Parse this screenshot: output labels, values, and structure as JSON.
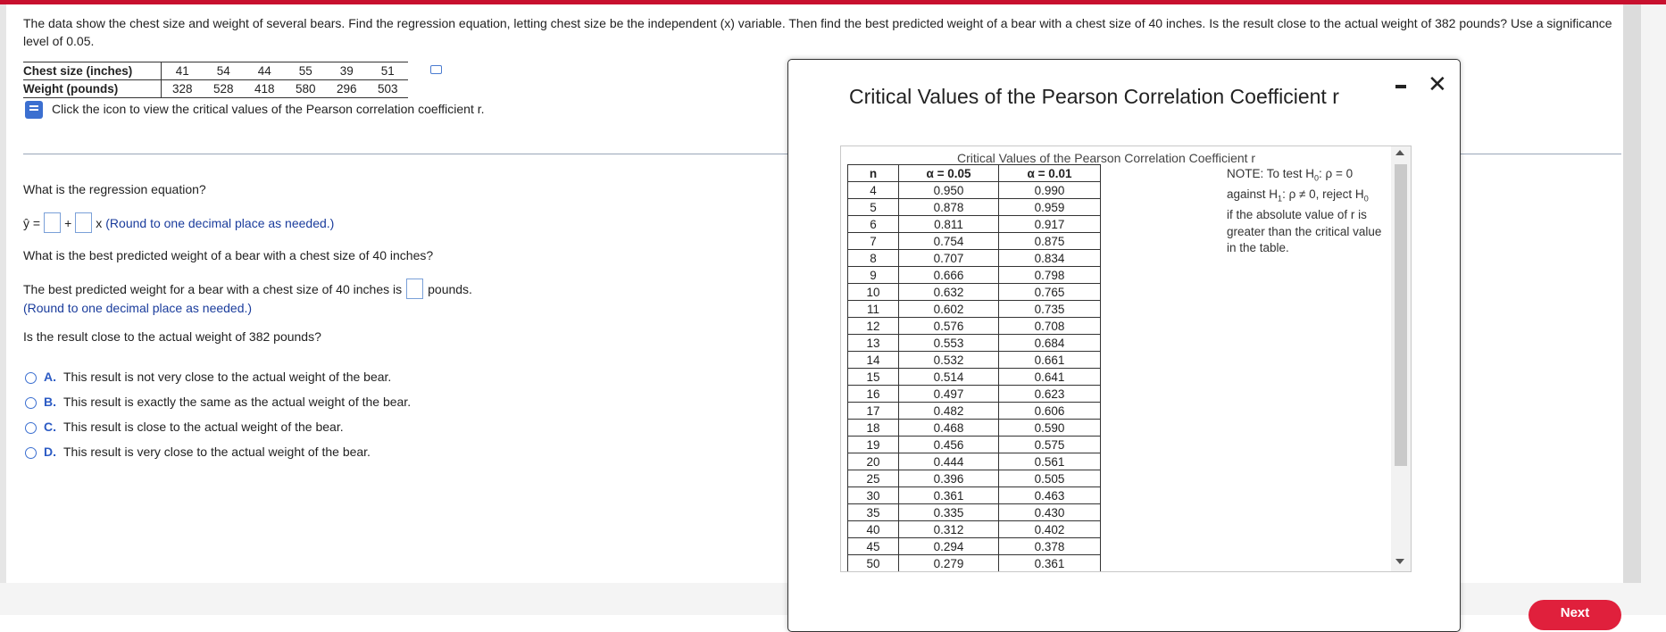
{
  "problem": {
    "text": "The data show the chest size and weight of several bears. Find the regression equation, letting chest size be the independent (x) variable. Then find the best predicted weight of a bear with a chest size of 40 inches. Is the result close to the actual weight of 382 pounds? Use a significance level of 0.05."
  },
  "data_table": {
    "row1_label": "Chest size (inches)",
    "row1_values": [
      "41",
      "54",
      "44",
      "55",
      "39",
      "51"
    ],
    "row2_label": "Weight (pounds)",
    "row2_values": [
      "328",
      "528",
      "418",
      "580",
      "296",
      "503"
    ]
  },
  "hint": "Click the icon to view the critical values of the Pearson correlation coefficient r.",
  "questions": {
    "q1": "What is the regression equation?",
    "eq_prefix": "ŷ =",
    "eq_plus": "+",
    "eq_x": "x",
    "eq_note": "(Round to one decimal place as needed.)",
    "q2": "What is the best predicted weight of a bear with a chest size of 40 inches?",
    "q2_answer_prefix": "The best predicted weight for a bear with a chest size of 40 inches is",
    "q2_answer_suffix": "pounds.",
    "q2_note": "(Round to one decimal place as needed.)",
    "q3": "Is the result close to the actual weight of 382 pounds?"
  },
  "options": [
    {
      "letter": "A.",
      "text": "This result is not very close to the actual weight of the bear."
    },
    {
      "letter": "B.",
      "text": "This result is exactly the same as the actual weight of the bear."
    },
    {
      "letter": "C.",
      "text": "This result is close to the actual weight of the bear."
    },
    {
      "letter": "D.",
      "text": "This result is very close to the actual weight of the bear."
    }
  ],
  "modal": {
    "title": "Critical Values of the Pearson Correlation Coefficient r",
    "minimize": "–",
    "close": "✕",
    "caption": "Critical Values of the Pearson Correlation Coefficient r",
    "headers": {
      "n": "n",
      "a05": "α = 0.05",
      "a01": "α = 0.01"
    },
    "rows": [
      [
        "4",
        "0.950",
        "0.990"
      ],
      [
        "5",
        "0.878",
        "0.959"
      ],
      [
        "6",
        "0.811",
        "0.917"
      ],
      [
        "7",
        "0.754",
        "0.875"
      ],
      [
        "8",
        "0.707",
        "0.834"
      ],
      [
        "9",
        "0.666",
        "0.798"
      ],
      [
        "10",
        "0.632",
        "0.765"
      ],
      [
        "11",
        "0.602",
        "0.735"
      ],
      [
        "12",
        "0.576",
        "0.708"
      ],
      [
        "13",
        "0.553",
        "0.684"
      ],
      [
        "14",
        "0.532",
        "0.661"
      ],
      [
        "15",
        "0.514",
        "0.641"
      ],
      [
        "16",
        "0.497",
        "0.623"
      ],
      [
        "17",
        "0.482",
        "0.606"
      ],
      [
        "18",
        "0.468",
        "0.590"
      ],
      [
        "19",
        "0.456",
        "0.575"
      ],
      [
        "20",
        "0.444",
        "0.561"
      ],
      [
        "25",
        "0.396",
        "0.505"
      ],
      [
        "30",
        "0.361",
        "0.463"
      ],
      [
        "35",
        "0.335",
        "0.430"
      ],
      [
        "40",
        "0.312",
        "0.402"
      ],
      [
        "45",
        "0.294",
        "0.378"
      ],
      [
        "50",
        "0.279",
        "0.361"
      ]
    ],
    "note_line1": "NOTE: To test H",
    "note_h0_sub": "0",
    "note_line1b": ": ρ = 0",
    "note_line2": "against H",
    "note_h1_sub": "1",
    "note_line2b": ": ρ ≠ 0, reject H",
    "note_h0b_sub": "0",
    "note_rest": "if the absolute value of r is greater than the critical value in the table."
  },
  "footer": {
    "next_label": "Next"
  },
  "colors": {
    "accent_red": "#c8102e",
    "link_blue": "#1a3c9c",
    "radio_blue": "#3b6fd0"
  }
}
